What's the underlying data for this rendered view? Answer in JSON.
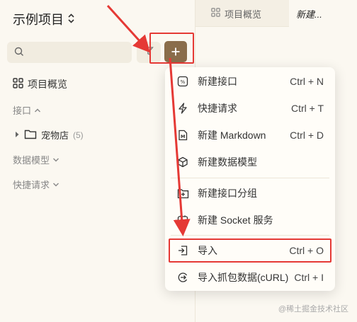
{
  "project": {
    "title": "示例项目",
    "chevron": "⌃⌄"
  },
  "sidebar": {
    "overview_label": "项目概览",
    "sections": {
      "api": "接口",
      "data_models": "数据模型",
      "quick_requests": "快捷请求"
    },
    "tree": {
      "folder_label": "宠物店",
      "count": "(5)"
    }
  },
  "tabs": [
    {
      "label": "项目概览"
    },
    {
      "label": "新建..."
    }
  ],
  "menu": {
    "items": [
      {
        "label": "新建接口",
        "shortcut": "Ctrl + N",
        "icon": "api-icon"
      },
      {
        "label": "快捷请求",
        "shortcut": "Ctrl + T",
        "icon": "lightning-icon"
      },
      {
        "label": "新建 Markdown",
        "shortcut": "Ctrl + D",
        "icon": "markdown-icon"
      },
      {
        "label": "新建数据模型",
        "shortcut": "",
        "icon": "cube-icon"
      },
      {
        "label": "新建接口分组",
        "shortcut": "",
        "icon": "folder-plus-icon"
      },
      {
        "label": "新建 Socket 服务",
        "shortcut": "",
        "icon": "socket-icon"
      },
      {
        "label": "导入",
        "shortcut": "Ctrl + O",
        "icon": "import-icon"
      },
      {
        "label": "导入抓包数据(cURL)",
        "shortcut": "Ctrl + I",
        "icon": "capture-icon"
      }
    ]
  },
  "watermark": "@稀土掘金技术社区",
  "colors": {
    "accent": "#8a6d4b",
    "highlight": "#e53935",
    "background": "#fbf8f1"
  }
}
